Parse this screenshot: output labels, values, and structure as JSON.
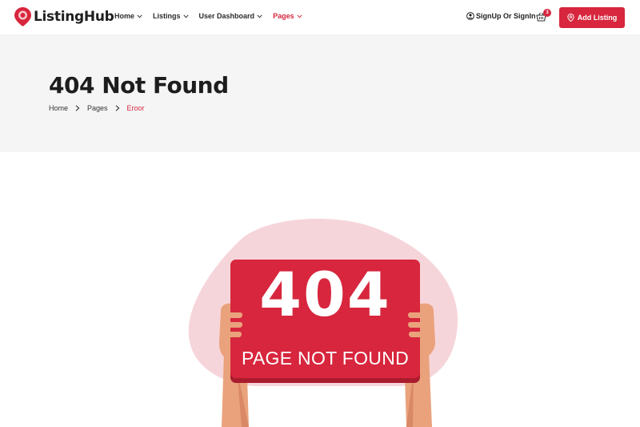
{
  "brand": {
    "name": "ListingHub",
    "accent": "#d7263d"
  },
  "nav": {
    "items": [
      {
        "label": "Home",
        "active": false
      },
      {
        "label": "Listings",
        "active": false
      },
      {
        "label": "User Dashboard",
        "active": false
      },
      {
        "label": "Pages",
        "active": true
      }
    ]
  },
  "header": {
    "signin_label": "SignUp Or SignIn",
    "cart_count": "3",
    "add_listing_label": "Add Listing"
  },
  "page": {
    "title": "404 Not Found",
    "breadcrumb": [
      "Home",
      "Pages",
      "Eroor"
    ]
  },
  "illustration": {
    "code": "404",
    "message": "PAGE NOT FOUND"
  },
  "icons": {
    "logo": "map-pin-icon",
    "signin": "user-circle-icon",
    "cart": "basket-icon",
    "add_listing": "map-pin-icon",
    "breadcrumb_separator": "chevron-right-icon",
    "nav_dropdown": "chevron-down-icon"
  }
}
